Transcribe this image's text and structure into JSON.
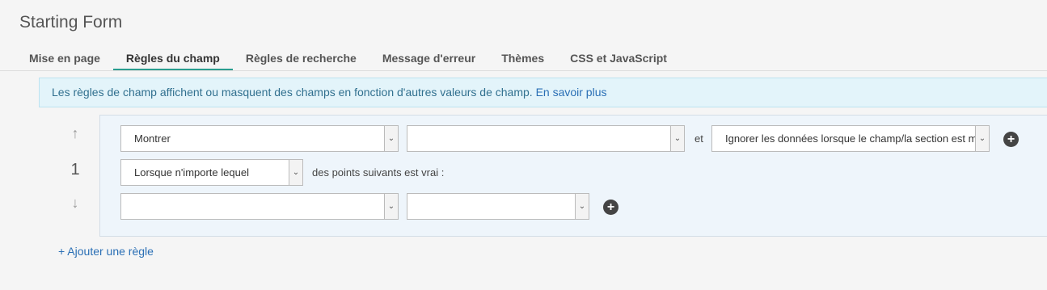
{
  "form_title": "Starting Form",
  "tabs": [
    {
      "label": "Mise en page"
    },
    {
      "label": "Règles du champ"
    },
    {
      "label": "Règles de recherche"
    },
    {
      "label": "Message d'erreur"
    },
    {
      "label": "Thèmes"
    },
    {
      "label": "CSS et JavaScript"
    }
  ],
  "active_tab": "Règles du champ",
  "info": {
    "text": "Les règles de champ affichent ou masquent des champs en fonction d'autres valeurs de champ.",
    "link": "En savoir plus"
  },
  "rule": {
    "number": "1",
    "action_select": "Montrer",
    "field_select": "",
    "and_label": "et",
    "data_select": "Ignorer les données lorsque le champ/la section est masqué(e)",
    "condition_select": "Lorsque n'importe lequel",
    "condition_text": "des points suivants est vrai :",
    "criteria_field_select": "",
    "criteria_value_select": ""
  },
  "add_rule_label": "+ Ajouter une règle",
  "colors": {
    "accent": "#2a9d8f",
    "link": "#2a6fb5",
    "info_bg": "#e3f4fa",
    "rule_bg": "#eef5fb"
  }
}
